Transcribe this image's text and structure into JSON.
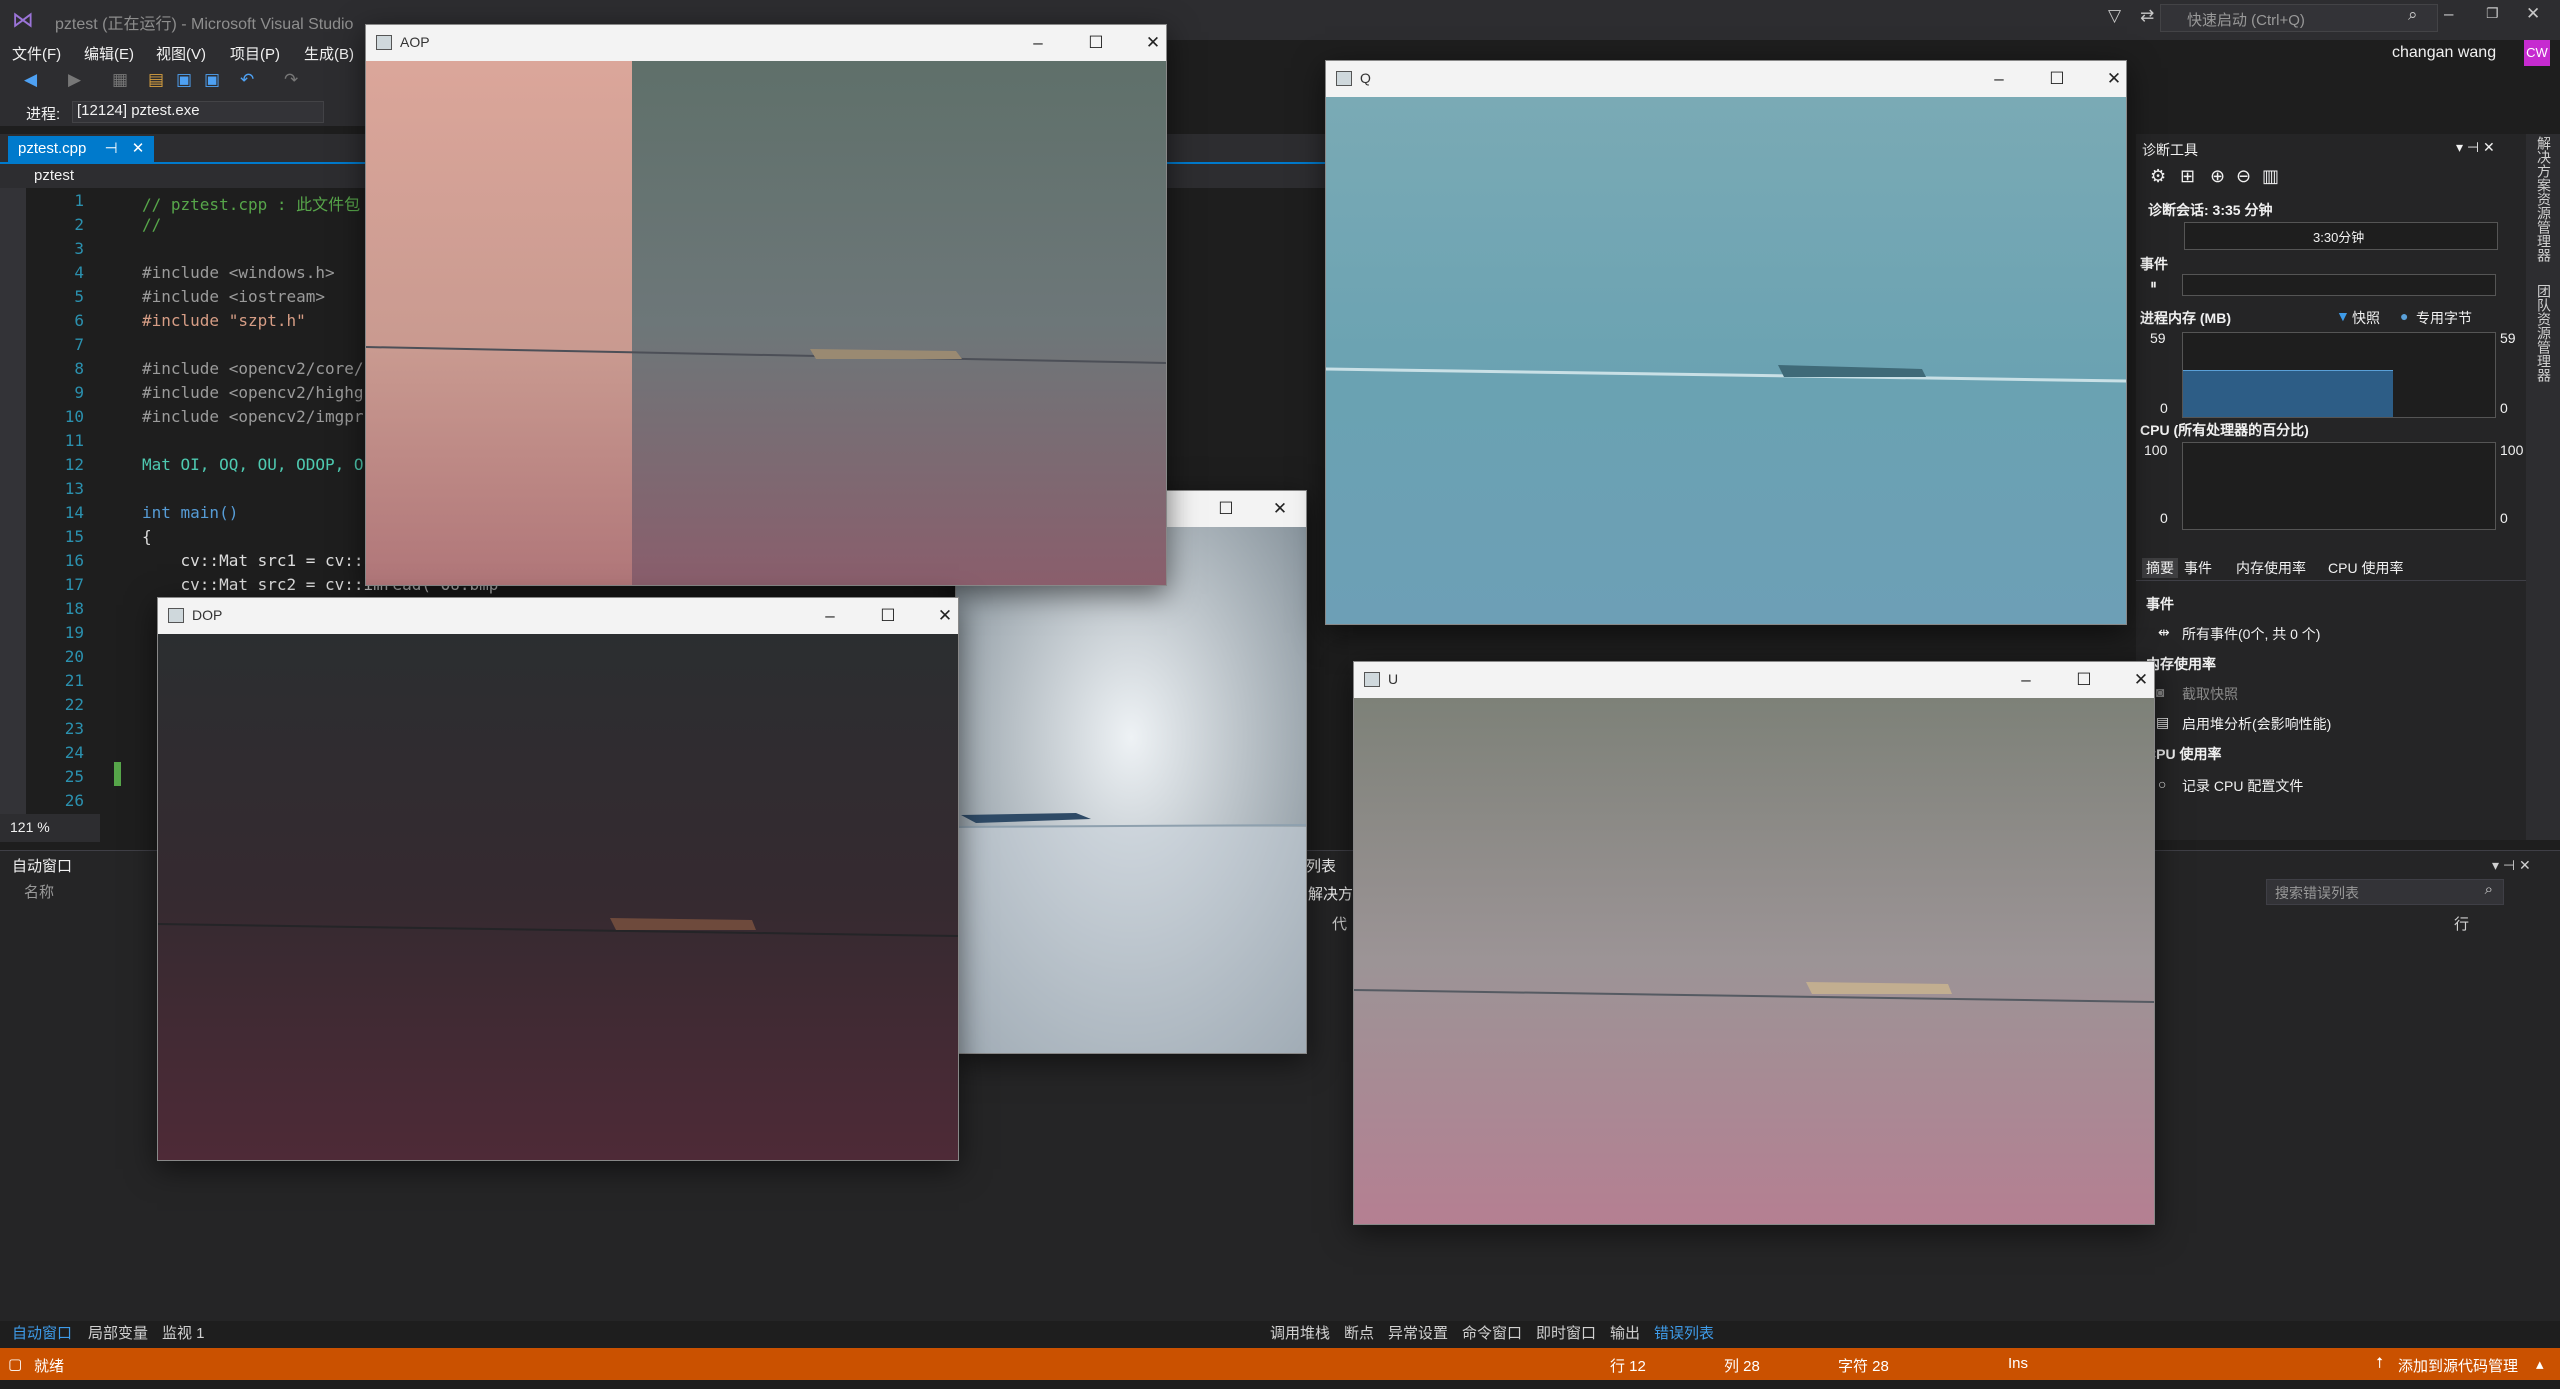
{
  "vs": {
    "title": "pztest (正在运行) - Microsoft Visual Studio",
    "quick_launch_placeholder": "快速启动 (Ctrl+Q)",
    "user": "changan wang",
    "avatar_initials": "CW",
    "menu": [
      "文件(F)",
      "编辑(E)",
      "视图(V)",
      "项目(P)",
      "生成(B)"
    ],
    "process_label": "进程:",
    "process_value": "[12124] pztest.exe",
    "doc_tab": "pztest.cpp",
    "nav_project": "pztest",
    "zoom": "121 %"
  },
  "code": {
    "line_numbers": [
      "1",
      "2",
      "3",
      "4",
      "5",
      "6",
      "7",
      "8",
      "9",
      "10",
      "11",
      "12",
      "13",
      "14",
      "15",
      "16",
      "17",
      "18",
      "19",
      "20",
      "21",
      "22",
      "23",
      "24",
      "25",
      "26"
    ],
    "lines": [
      "// pztest.cpp : 此文件包",
      "//",
      "",
      "#include <windows.h>",
      "#include <iostream>",
      "#include \"szpt.h\"",
      "",
      "#include <opencv2/core/",
      "#include <opencv2/highg",
      "#include <opencv2/imgpr",
      "",
      "Mat OI, OQ, OU, ODOP, O",
      "",
      "int main()",
      "{",
      "    cv::Mat src1 = cv::",
      "    cv::Mat src2 = cv::imread(\"OU.bmp\""
    ]
  },
  "auto_pane": {
    "title": "自动窗口",
    "column": "名称",
    "tabs": [
      "自动窗口",
      "局部变量",
      "监视 1"
    ]
  },
  "error_pane": {
    "title_fragment": "列表",
    "solution_fragment": "解决方",
    "code_fragment": "代",
    "search_placeholder": "搜索错误列表",
    "line_col": "行",
    "tabs": [
      "调用堆栈",
      "断点",
      "异常设置",
      "命令窗口",
      "即时窗口",
      "输出",
      "错误列表"
    ]
  },
  "diag": {
    "title": "诊断工具",
    "session": "诊断会话: 3:35 分钟",
    "timeline_label": "3:30分钟",
    "events_header": "事件",
    "memory_header": "进程内存 (MB)",
    "legend_snapshot": "快照",
    "legend_private": "专用字节",
    "mem_max_left": "59",
    "mem_max_right": "59",
    "mem_min_left": "0",
    "mem_min_right": "0",
    "cpu_header": "CPU (所有处理器的百分比)",
    "cpu_max_left": "100",
    "cpu_max_right": "100",
    "cpu_min_left": "0",
    "cpu_min_right": "0",
    "tabs": [
      "摘要",
      "事件",
      "内存使用率",
      "CPU 使用率"
    ],
    "sec_events": "事件",
    "all_events": "所有事件(0个, 共 0 个)",
    "sec_memory": "内存使用率",
    "take_snapshot": "截取快照",
    "heap_analysis": "启用堆分析(会影响性能)",
    "sec_cpu": "CPU 使用率",
    "record_cpu": "记录 CPU 配置文件",
    "memory_level": 0.55
  },
  "right_strip": [
    "解决方案资源管理器",
    "团队资源管理器"
  ],
  "status": {
    "ready": "就绪",
    "row": "行 12",
    "col": "列 28",
    "char": "字符 28",
    "ins": "Ins",
    "source_control": "添加到源代码管理"
  },
  "windows": {
    "aop": "AOP",
    "q": "Q",
    "dop": "DOP",
    "u": "U"
  },
  "colors": {
    "accent": "#007acc",
    "status_bar": "#ca5100"
  }
}
